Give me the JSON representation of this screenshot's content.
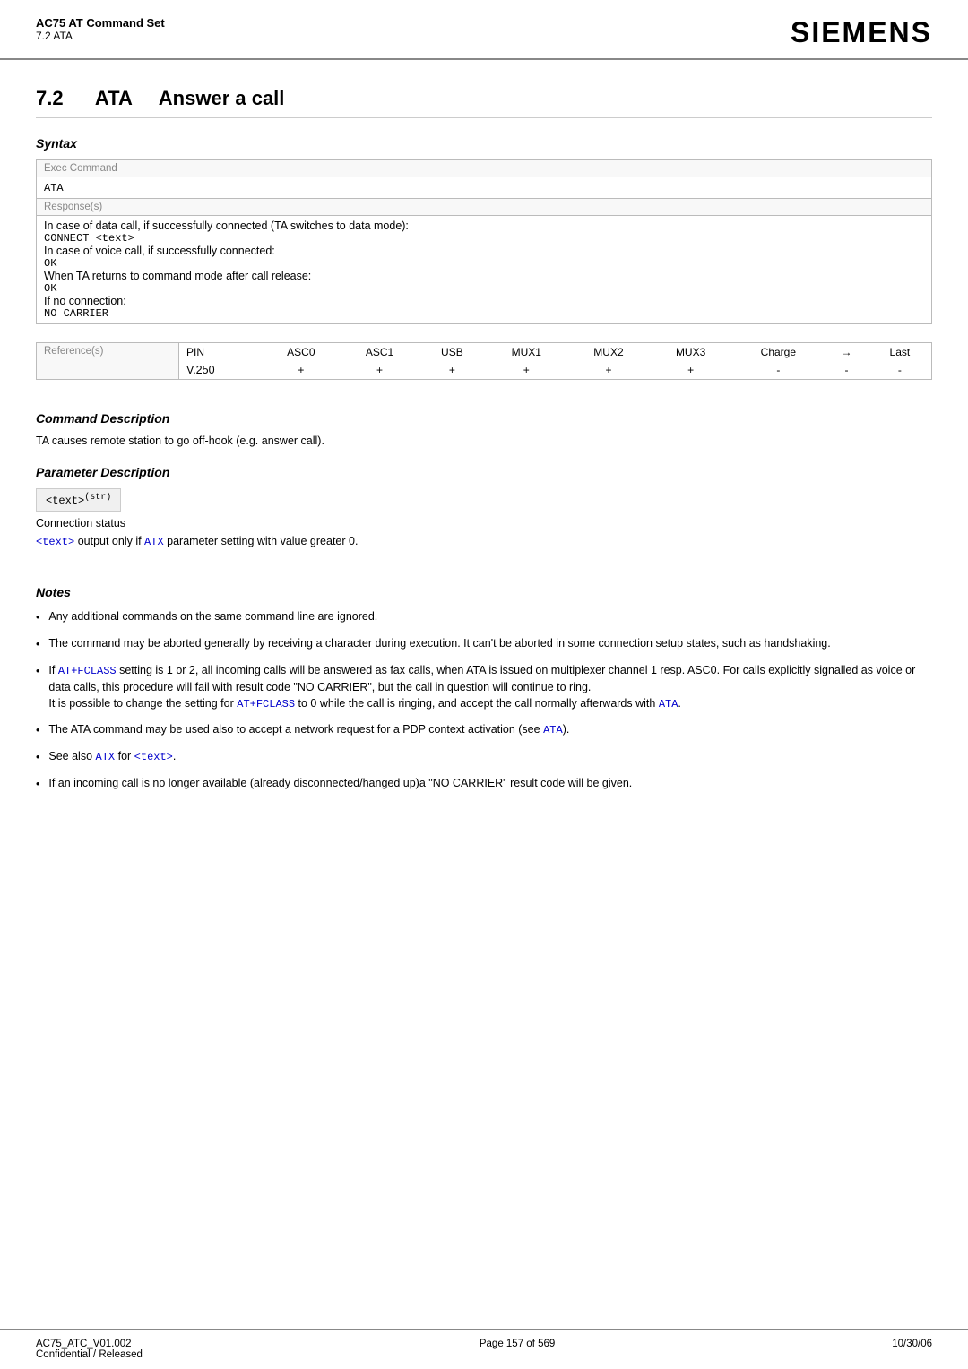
{
  "header": {
    "doc_title": "AC75 AT Command Set",
    "doc_subtitle": "7.2 ATA",
    "brand": "SIEMENS"
  },
  "section": {
    "number": "7.2",
    "command": "ATA",
    "title": "Answer a call"
  },
  "syntax": {
    "label": "Syntax",
    "exec_command_label": "Exec Command",
    "exec_command_value": "ATA",
    "responses_label": "Response(s)",
    "response_lines": [
      "In case of data call, if successfully connected (TA switches to data mode):",
      "CONNECT <text>",
      "In case of voice call, if successfully connected:",
      "OK",
      "When TA returns to command mode after call release:",
      "OK",
      "If no connection:",
      "NO CARRIER"
    ],
    "reference_label": "Reference(s)",
    "reference_value": "V.250",
    "table_headers": [
      "PIN",
      "ASC0",
      "ASC1",
      "USB",
      "MUX1",
      "MUX2",
      "MUX3",
      "Charge",
      "→",
      "Last"
    ],
    "table_values": [
      "+",
      "+",
      "+",
      "+",
      "+",
      "+",
      "+",
      "-",
      "-",
      "-"
    ]
  },
  "command_description": {
    "title": "Command Description",
    "text": "TA causes remote station to go off-hook (e.g. answer call)."
  },
  "parameter_description": {
    "title": "Parameter Description",
    "param_name": "<text>",
    "param_superscript": "(str)",
    "param_desc": "Connection status",
    "param_note_prefix": "<text>",
    "param_note_middle": " output only if ",
    "param_note_atx": "ATX",
    "param_note_suffix": " parameter setting with value greater 0."
  },
  "notes": {
    "title": "Notes",
    "items": [
      {
        "text": "Any additional commands on the same command line are ignored."
      },
      {
        "text": "The command may be aborted generally by receiving a character during execution. It can't be aborted in some connection setup states, such as handshaking."
      },
      {
        "text_parts": [
          {
            "type": "text",
            "value": "If "
          },
          {
            "type": "blue_mono",
            "value": "AT+FCLASS"
          },
          {
            "type": "text",
            "value": " setting is 1 or 2, all incoming calls will be answered as fax calls, when ATA is issued on multiplexer channel 1 resp. ASC0. For calls explicitly signalled as voice or data calls, this procedure will fail with result code \"NO CARRIER\", but the call in question will continue to ring.\nIt is possible to change the setting for "
          },
          {
            "type": "blue_mono",
            "value": "AT+FCLASS"
          },
          {
            "type": "text",
            "value": " to 0 while the call is ringing, and accept the call normally afterwards with "
          },
          {
            "type": "blue_mono",
            "value": "ATA"
          },
          {
            "type": "text",
            "value": "."
          }
        ]
      },
      {
        "text_parts": [
          {
            "type": "text",
            "value": "The ATA command may be used also to accept a network request for a PDP context activation (see "
          },
          {
            "type": "blue_mono",
            "value": "ATA"
          },
          {
            "type": "text",
            "value": ")."
          }
        ]
      },
      {
        "text_parts": [
          {
            "type": "text",
            "value": "See also "
          },
          {
            "type": "blue_mono",
            "value": "ATX"
          },
          {
            "type": "text",
            "value": " for "
          },
          {
            "type": "blue_mono",
            "value": "<text>"
          },
          {
            "type": "text",
            "value": "."
          }
        ]
      },
      {
        "text": "If an incoming call is no longer available (already disconnected/hanged up)a \"NO CARRIER\" result code will be given."
      }
    ]
  },
  "footer": {
    "left": "AC75_ATC_V01.002\nConfidential / Released",
    "center": "Page 157 of 569",
    "right": "10/30/06"
  }
}
